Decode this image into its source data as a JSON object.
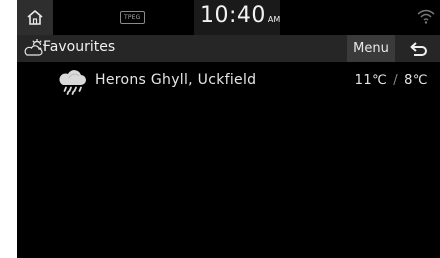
{
  "status": {
    "source_label": "TPEG",
    "time": "10:40",
    "ampm": "AM"
  },
  "header": {
    "title": "Favourites",
    "menu_label": "Menu"
  },
  "favourites": [
    {
      "location": "Herons Ghyll, Uckfield",
      "high": "11℃",
      "separator": "/",
      "low": "8℃",
      "weather_icon": "cloud-rain-icon"
    }
  ],
  "icons": {
    "home": "home-icon",
    "wifi": "wifi-icon",
    "title": "partly-sunny-icon",
    "back": "back-arrow-icon"
  }
}
